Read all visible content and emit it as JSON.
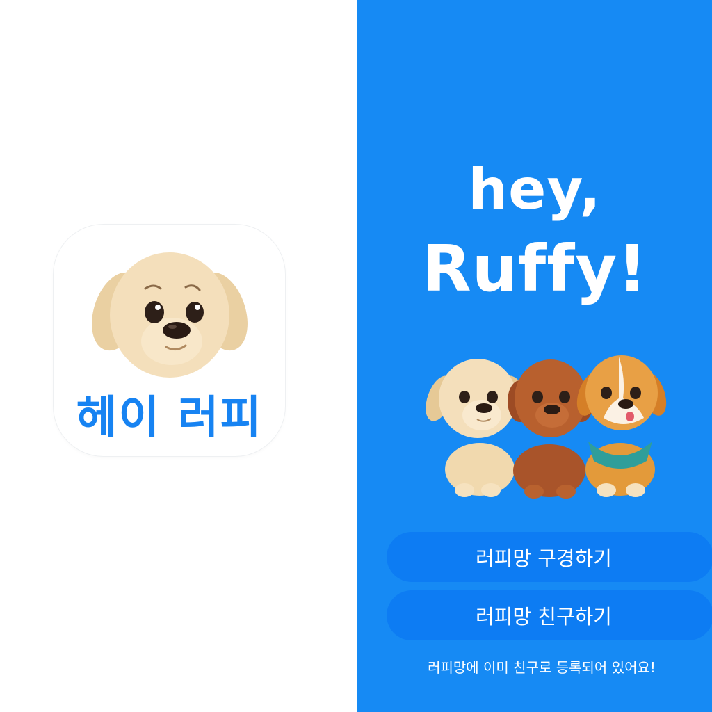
{
  "app_icon": {
    "title": "헤이 러피",
    "dog_icon": "puppy-face-icon",
    "text_color": "#1783f2"
  },
  "splash": {
    "background_color": "#168af4",
    "headline_line1": "hey,",
    "headline_line2": "Ruffy!",
    "illustration": "three-puppies-illustration",
    "buttons": {
      "browse_label": "러피망 구경하기",
      "invite_label": "러피망 친구하기"
    },
    "footer_text": "러피망에 이미 친구로 등록되어 있어요!",
    "footer_link": "",
    "footer_raw": "러피망에 이미 친구로 등록되어 있어요!"
  }
}
